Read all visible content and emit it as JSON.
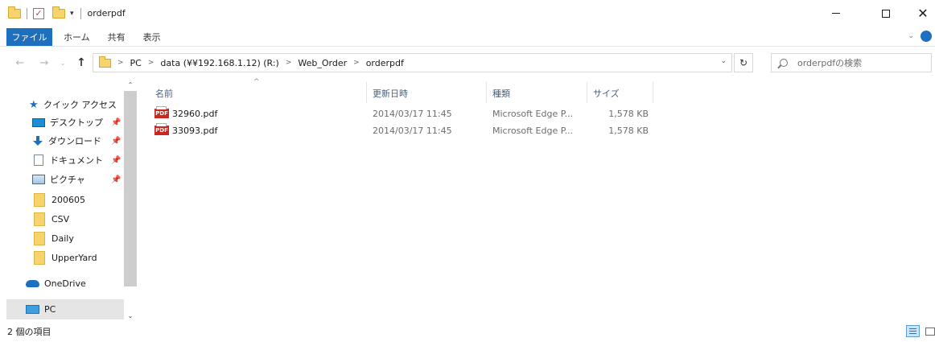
{
  "window": {
    "title": "orderpdf",
    "minimize_icon": "minimize-icon",
    "maximize_icon": "maximize-icon",
    "close_glyph": "✕"
  },
  "ribbon": {
    "file_tab": "ファイル",
    "tabs": [
      "ホーム",
      "共有",
      "表示"
    ]
  },
  "address": {
    "crumbs": [
      "PC",
      "data (¥¥192.168.1.12) (R:)",
      "Web_Order",
      "orderpdf"
    ]
  },
  "search": {
    "placeholder": "orderpdfの検索"
  },
  "nav_pane": {
    "quick_access": "クイック アクセス",
    "items": [
      {
        "label": "デスクトップ",
        "icon": "desktop-icon",
        "pinned": true
      },
      {
        "label": "ダウンロード",
        "icon": "download-icon",
        "pinned": true
      },
      {
        "label": "ドキュメント",
        "icon": "document-icon",
        "pinned": true
      },
      {
        "label": "ピクチャ",
        "icon": "pictures-icon",
        "pinned": true
      },
      {
        "label": "200605",
        "icon": "folder-icon",
        "pinned": false
      },
      {
        "label": "CSV",
        "icon": "folder-icon",
        "pinned": false
      },
      {
        "label": "Daily",
        "icon": "folder-icon",
        "pinned": false
      },
      {
        "label": "UpperYard",
        "icon": "folder-icon",
        "pinned": false
      }
    ],
    "onedrive": "OneDrive",
    "pc": "PC"
  },
  "file_list": {
    "columns": [
      "名前",
      "更新日時",
      "種類",
      "サイズ"
    ],
    "rows": [
      {
        "name": "32960.pdf",
        "modified": "2014/03/17 11:45",
        "type": "Microsoft Edge P...",
        "size": "1,578 KB"
      },
      {
        "name": "33093.pdf",
        "modified": "2014/03/17 11:45",
        "type": "Microsoft Edge P...",
        "size": "1,578 KB"
      }
    ]
  },
  "status": {
    "item_count": "2 個の項目"
  },
  "colors": {
    "accent": "#1f6fbf",
    "folder": "#f7d36b",
    "pdf_red": "#c8281f",
    "selected_bg": "#e5e5e5"
  }
}
